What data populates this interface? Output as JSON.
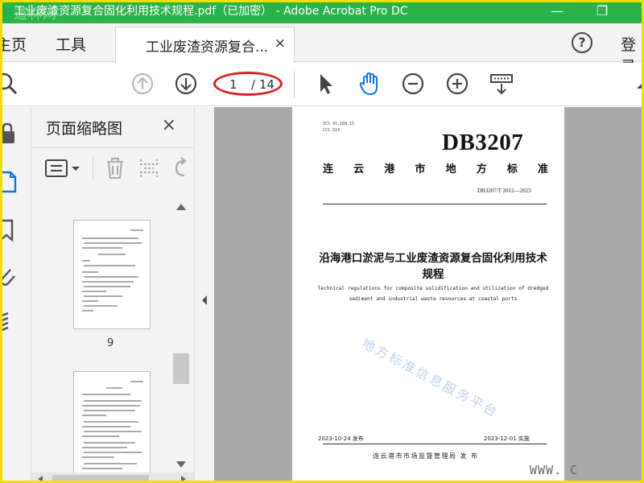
{
  "window": {
    "title": "工业废渣资源复合固化利用技术规程.pdf（已加密） - Adobe Acrobat Pro DC",
    "watermark_logo": "道林网",
    "minimize_glyph": "—",
    "restore_glyph": "❐"
  },
  "nav": {
    "home": "主页",
    "tools": "工具",
    "doc_tab_label": "工业废渣资源复合...",
    "doc_tab_close": "×",
    "help": "?",
    "login": "登录"
  },
  "toolbar": {
    "current_page": "1",
    "total_pages": "/ 14"
  },
  "thumbnails": {
    "panel_title": "页面缩略图",
    "close": "×",
    "pages": [
      {
        "number": "9"
      },
      {
        "number": ""
      }
    ]
  },
  "document": {
    "ics": "ICS 91.100.15",
    "ccs": "CCS Q13",
    "code": "DB3207",
    "issuer_region": [
      "连",
      "云",
      "港",
      "市",
      "地",
      "方",
      "标",
      "准"
    ],
    "std_number": "DB3207/T 2012—2023",
    "title": "沿海港口淤泥与工业废渣资源复合固化利用技术规程",
    "title_en": "Technical regulations for composite solidification and utilization of dredged sediment and industrial waste resources at coastal ports",
    "watermark": "地方标准信息服务平台",
    "release": "2023-10-24 发布",
    "implement": "2023-12-01 实施",
    "publisher": "连云港市市场监督管理局    发 布",
    "footer_wm": "WWW. C"
  },
  "colors": {
    "title_bar": "#2ab34a",
    "highlight_oval": "#d8232a",
    "frame": "#f0e000",
    "doc_bg": "#a9a9a9",
    "hand_tool": "#1473e6"
  }
}
